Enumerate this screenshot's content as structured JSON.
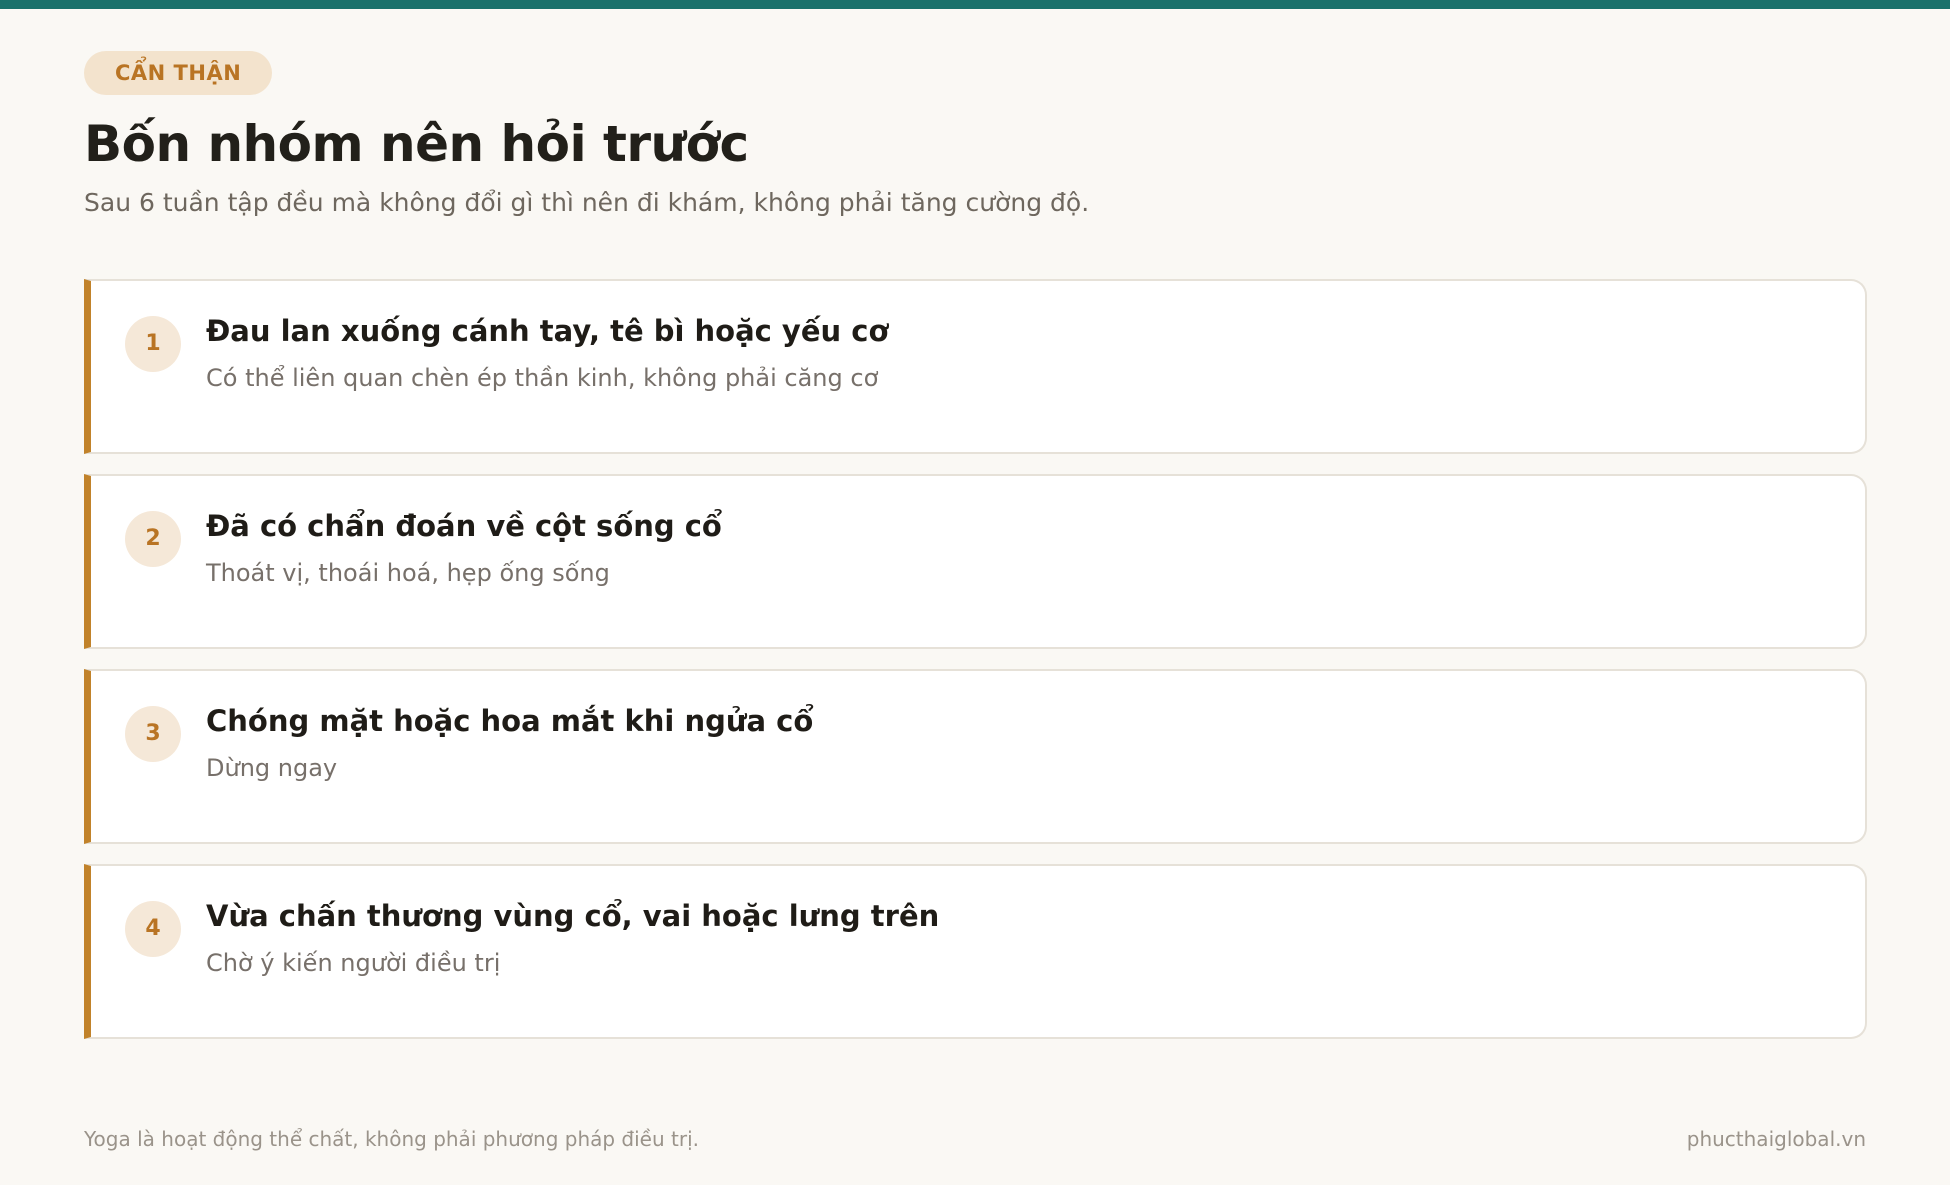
{
  "colors": {
    "top_bar": "#1a716b",
    "accent": "#c1822a",
    "badge_bg": "#f3e3cd",
    "badge_text": "#b97424",
    "background": "#faf8f4"
  },
  "header": {
    "badge": "CẨN THẬN",
    "title": "Bốn nhóm nên hỏi trước",
    "subtitle": "Sau 6 tuần tập đều mà không đổi gì thì nên đi khám, không phải tăng cường độ."
  },
  "items": [
    {
      "number": "1",
      "title": "Đau lan xuống cánh tay, tê bì hoặc yếu cơ",
      "description": "Có thể liên quan chèn ép thần kinh, không phải căng cơ"
    },
    {
      "number": "2",
      "title": "Đã có chẩn đoán về cột sống cổ",
      "description": "Thoát vị, thoái hoá, hẹp ống sống"
    },
    {
      "number": "3",
      "title": "Chóng mặt hoặc hoa mắt khi ngửa cổ",
      "description": "Dừng ngay"
    },
    {
      "number": "4",
      "title": "Vừa chấn thương vùng cổ, vai hoặc lưng trên",
      "description": "Chờ ý kiến người điều trị"
    }
  ],
  "footer": {
    "disclaimer": "Yoga là hoạt động thể chất, không phải phương pháp điều trị.",
    "site": "phucthaiglobal.vn"
  }
}
